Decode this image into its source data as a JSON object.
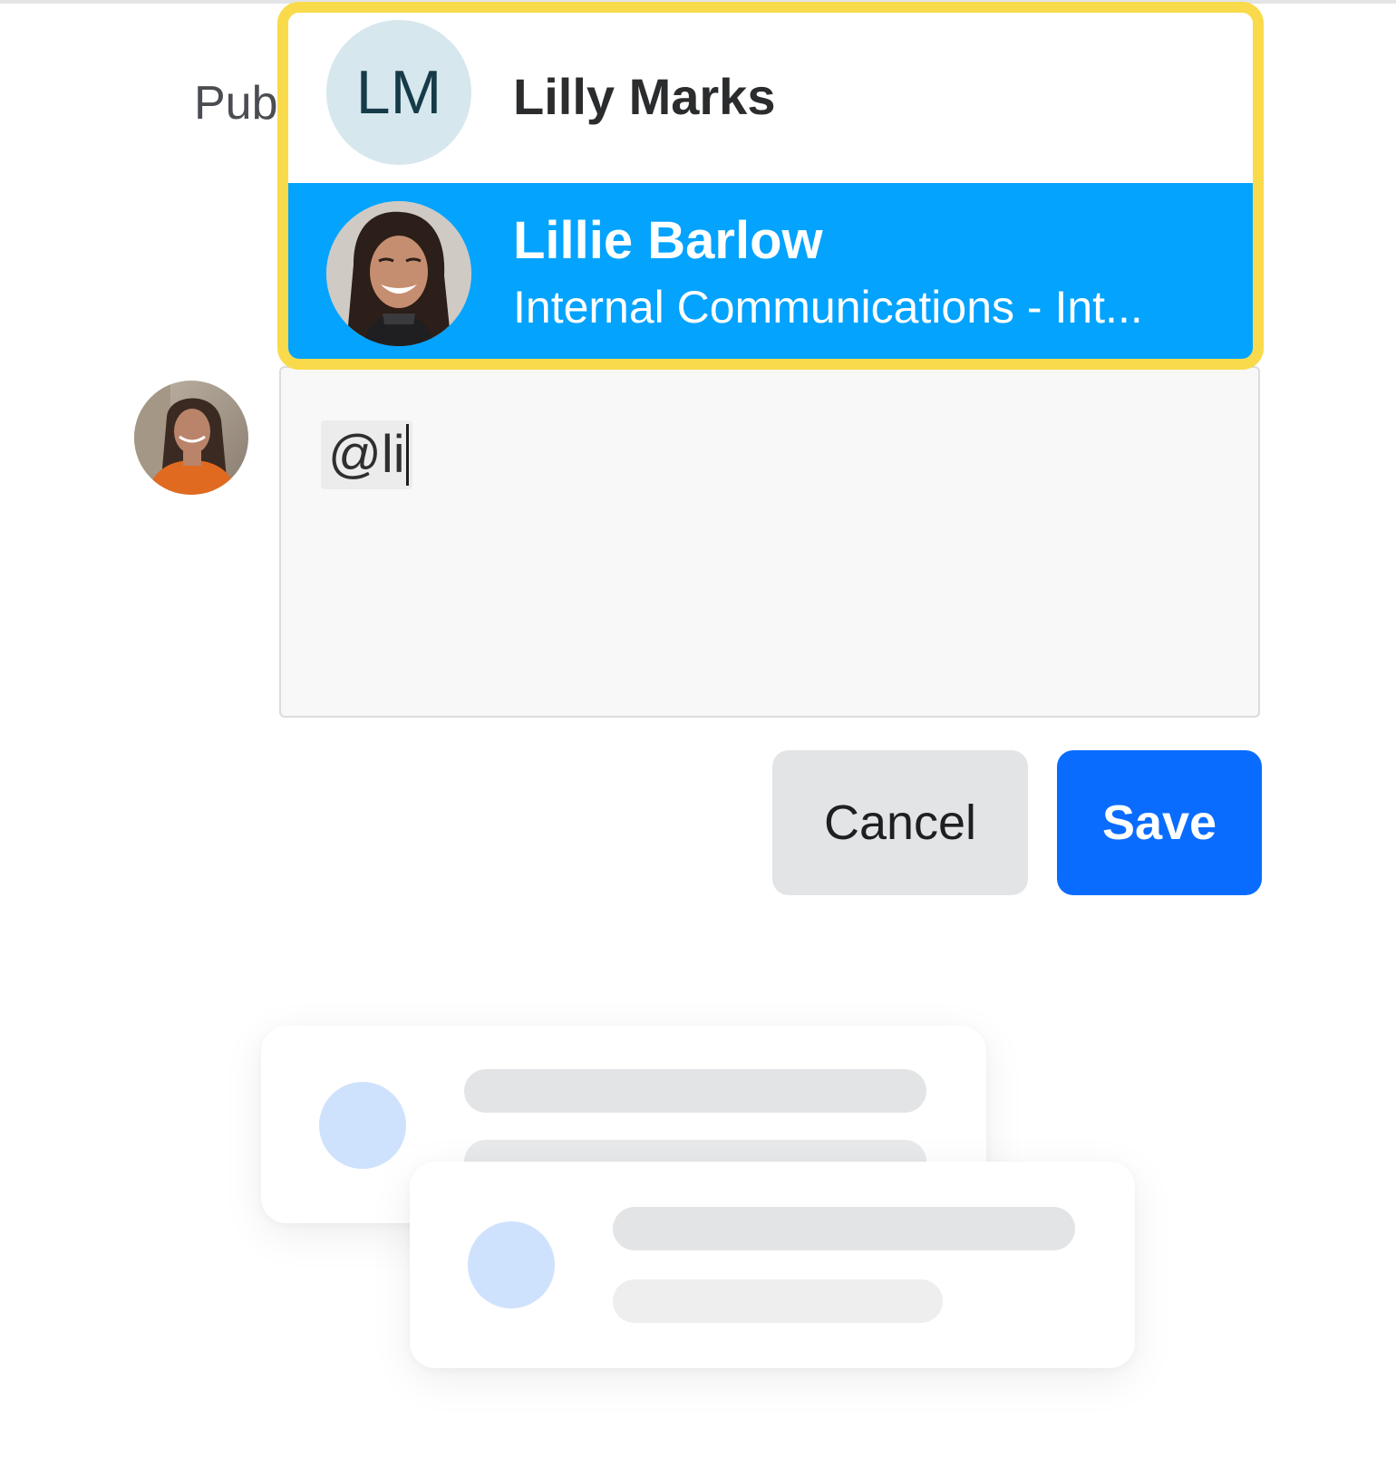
{
  "background_label": "Pub",
  "mention_dropdown": {
    "highlight_color": "#f9da4b",
    "selected_bg_color": "#03a3fe",
    "options": [
      {
        "initials": "LM",
        "name": "Lilly Marks",
        "subtitle": "",
        "selected": false
      },
      {
        "initials": "",
        "name": "Lillie Barlow",
        "subtitle": "Internal Communications - Int...",
        "selected": true
      }
    ]
  },
  "comment_input": {
    "value": "@li"
  },
  "actions": {
    "cancel_label": "Cancel",
    "save_label": "Save",
    "save_color": "#0a6cff"
  },
  "placeholder_cards": {
    "count": 2,
    "icon": "skeleton-placeholder"
  }
}
